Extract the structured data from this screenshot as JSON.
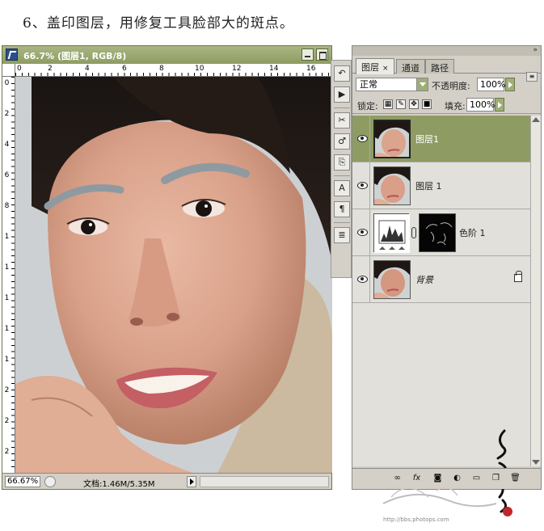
{
  "caption": "6、盖印图层，用修复工具脸部大的斑点。",
  "document": {
    "title": "66.7% (图层1, RGB/8)",
    "ruler_h": [
      "0",
      "2",
      "4",
      "6",
      "8",
      "10",
      "12",
      "14",
      "16"
    ],
    "ruler_v": [
      "0",
      "2",
      "4",
      "6",
      "8",
      "1",
      "1",
      "1",
      "1",
      "1",
      "2",
      "2",
      "2"
    ],
    "status": {
      "zoom": "66.67%",
      "doc_info": "文档:1.46M/5.35M"
    }
  },
  "toolbar": {
    "icons": [
      "history-icon",
      "actions-icon",
      "tool-presets-icon",
      "brushes-icon",
      "clone-source-icon",
      "character-icon",
      "paragraph-icon",
      "layer-comps-icon"
    ]
  },
  "layers_panel": {
    "tabs": [
      {
        "label": "图层",
        "active": true
      },
      {
        "label": "通道",
        "active": false
      },
      {
        "label": "路径",
        "active": false
      }
    ],
    "blend_mode": "正常",
    "opacity_label": "不透明度:",
    "opacity_value": "100%",
    "lock_label": "锁定:",
    "fill_label": "填充:",
    "fill_value": "100%",
    "layers": [
      {
        "name": "图层1",
        "selected": true,
        "type": "photo"
      },
      {
        "name": "图层 1",
        "selected": false,
        "type": "photo"
      },
      {
        "name": "色阶 1",
        "selected": false,
        "type": "adjustment"
      },
      {
        "name": "背景",
        "selected": false,
        "type": "photo",
        "locked": true
      }
    ],
    "bottom_icons": [
      "link-layers-icon",
      "layer-style-icon",
      "layer-mask-icon",
      "adjustment-layer-icon",
      "group-icon",
      "new-layer-icon",
      "delete-layer-icon"
    ]
  },
  "watermark": {
    "url": "http://bbs.photops.com"
  },
  "colors": {
    "accent": "#8e9c63",
    "panel_bg": "#d4d0c8"
  }
}
